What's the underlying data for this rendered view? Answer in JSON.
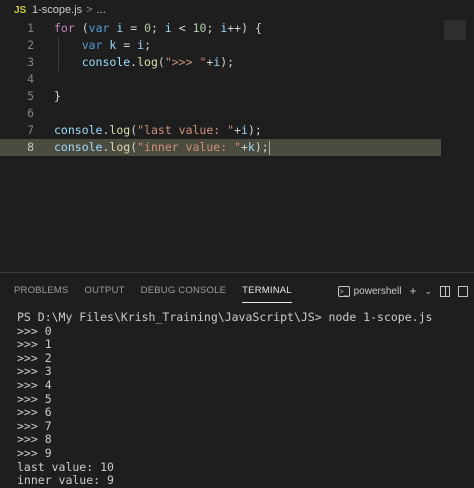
{
  "breadcrumb": {
    "icon": "JS",
    "file": "1-scope.js",
    "separator": ">",
    "rest": "..."
  },
  "editor": {
    "line_numbers": [
      "1",
      "2",
      "3",
      "4",
      "5",
      "6",
      "7",
      "8"
    ],
    "active_line": 8,
    "lines": [
      [
        [
          "kw",
          "for"
        ],
        [
          "op",
          " ("
        ],
        [
          "kw2",
          "var"
        ],
        [
          "op",
          " "
        ],
        [
          "var",
          "i"
        ],
        [
          "op",
          " = "
        ],
        [
          "num",
          "0"
        ],
        [
          "op",
          "; "
        ],
        [
          "var",
          "i"
        ],
        [
          "op",
          " < "
        ],
        [
          "num",
          "10"
        ],
        [
          "op",
          "; "
        ],
        [
          "var",
          "i"
        ],
        [
          "op",
          "++) {"
        ]
      ],
      [
        [
          "op",
          "    "
        ],
        [
          "kw2",
          "var"
        ],
        [
          "op",
          " "
        ],
        [
          "var",
          "k"
        ],
        [
          "op",
          " = "
        ],
        [
          "var",
          "i"
        ],
        [
          "op",
          ";"
        ]
      ],
      [
        [
          "op",
          "    "
        ],
        [
          "var",
          "console"
        ],
        [
          "op",
          "."
        ],
        [
          "fn",
          "log"
        ],
        [
          "op",
          "("
        ],
        [
          "str",
          "\">>> \""
        ],
        [
          "op",
          "+"
        ],
        [
          "var",
          "i"
        ],
        [
          "op",
          ");"
        ]
      ],
      [],
      [
        [
          "op",
          "}"
        ]
      ],
      [],
      [
        [
          "var",
          "console"
        ],
        [
          "op",
          "."
        ],
        [
          "fn",
          "log"
        ],
        [
          "op",
          "("
        ],
        [
          "str",
          "\"last value: \""
        ],
        [
          "op",
          "+"
        ],
        [
          "var",
          "i"
        ],
        [
          "op",
          ");"
        ]
      ],
      [
        [
          "var",
          "console"
        ],
        [
          "op",
          "."
        ],
        [
          "fn",
          "log"
        ],
        [
          "op",
          "("
        ],
        [
          "str",
          "\"inner value: \""
        ],
        [
          "op",
          "+"
        ],
        [
          "var",
          "k"
        ],
        [
          "op",
          ");"
        ]
      ]
    ]
  },
  "panel": {
    "tabs": [
      "PROBLEMS",
      "OUTPUT",
      "DEBUG CONSOLE",
      "TERMINAL"
    ],
    "active_tab": "TERMINAL",
    "shell": "powershell"
  },
  "terminal": {
    "lines": [
      "PS D:\\My Files\\Krish_Training\\JavaScript\\JS> node 1-scope.js",
      ">>> 0",
      ">>> 1",
      ">>> 2",
      ">>> 3",
      ">>> 4",
      ">>> 5",
      ">>> 6",
      ">>> 7",
      ">>> 8",
      ">>> 9",
      "last value: 10",
      "inner value: 9"
    ]
  }
}
